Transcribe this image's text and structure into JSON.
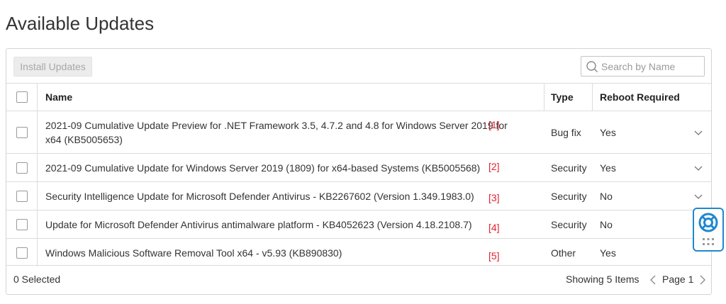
{
  "page": {
    "title": "Available Updates"
  },
  "toolbar": {
    "install_label": "Install Updates",
    "search_placeholder": "Search by Name"
  },
  "table": {
    "headers": {
      "name": "Name",
      "type": "Type",
      "reboot": "Reboot Required"
    },
    "rows": [
      {
        "name": "2021-09 Cumulative Update Preview for .NET Framework 3.5, 4.7.2 and 4.8 for Windows Server 2019 for x64 (KB5005653)",
        "ref": "[1]",
        "type": "Bug fix",
        "reboot": "Yes"
      },
      {
        "name": "2021-09 Cumulative Update for Windows Server 2019 (1809) for x64-based Systems (KB5005568)",
        "ref": "[2]",
        "type": "Security",
        "reboot": "Yes"
      },
      {
        "name": "Security Intelligence Update for Microsoft Defender Antivirus - KB2267602 (Version 1.349.1983.0)",
        "ref": "[3]",
        "type": "Security",
        "reboot": "No"
      },
      {
        "name": "Update for Microsoft Defender Antivirus antimalware platform - KB4052623 (Version 4.18.2108.7)",
        "ref": "[4]",
        "type": "Security",
        "reboot": "No"
      },
      {
        "name": "Windows Malicious Software Removal Tool x64 - v5.93 (KB890830)",
        "ref": "[5]",
        "type": "Other",
        "reboot": "Yes"
      }
    ]
  },
  "footer": {
    "selected": "0 Selected",
    "showing": "Showing 5 Items",
    "page": "Page 1"
  },
  "colors": {
    "accent": "#1e88d0",
    "ref_red": "#e0232f",
    "border": "#dcdcdc"
  },
  "icons": {
    "search": "search-icon",
    "expand": "chevron-down-icon",
    "prev": "chevron-left-icon",
    "next": "chevron-right-icon",
    "help": "lifebuoy-icon",
    "drag": "drag-handle-icon"
  }
}
